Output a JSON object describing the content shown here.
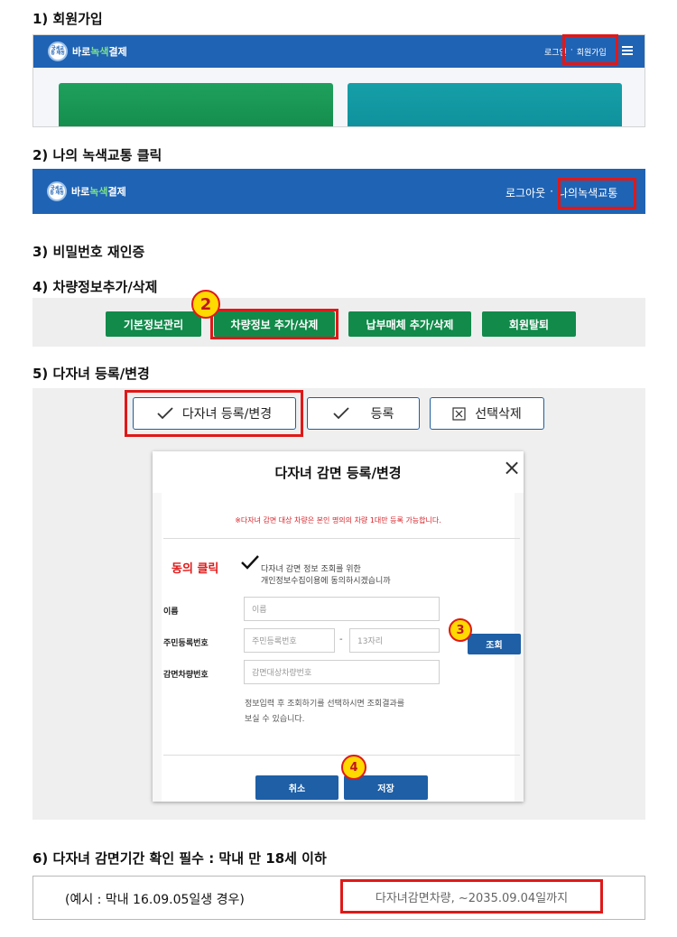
{
  "steps": {
    "s1": "1) 회원가입",
    "s2": "2) 나의 녹색교통 클릭",
    "s3": "3) 비밀번호 재인증",
    "s4": "4) 차량정보추가/삭제",
    "s5": "5) 다자녀 등록/변경",
    "s6": "6) 다자녀 감면기간 확인 필수 : 막내 만 18세 이하"
  },
  "logo": {
    "badge": "국세교통 재정",
    "text_a": "바로",
    "text_b": "녹색",
    "text_c": "결제"
  },
  "nav1": {
    "login": "로그인",
    "dot": "·",
    "signup": "회원가입"
  },
  "nav2": {
    "logout": "로그아웃",
    "dot": "·",
    "mygreen": "나의녹색교통"
  },
  "menu_buttons": [
    "기본정보관리",
    "차량정보 추가/삭제",
    "납부매체 추가/삭제",
    "회원탈퇴"
  ],
  "action_buttons": {
    "register_change": "다자녀 등록/변경",
    "register": "등록",
    "delete_selected": "선택삭제"
  },
  "badges": {
    "b2": "2",
    "b3": "3",
    "b4": "4"
  },
  "modal": {
    "title": "다자녀 감면 등록/변경",
    "close": "×",
    "notice": "※다자녀 감면 대상 차량은 본인 명의의 차량 1대만 등록 가능합니다.",
    "agree_label": "동의 클릭",
    "agree_text_1": "다자녀 감면 정보 조회를 위한",
    "agree_text_2": "개인정보수집이용에 동의하시겠습니까",
    "name_label": "이름",
    "name_placeholder": "이름",
    "rrn_label": "주민등록번호",
    "rrn_placeholder_1": "주민등록번호",
    "rrn_dash": "-",
    "rrn_placeholder_2": "13자리",
    "query_button": "조회",
    "car_label": "감면차량번호",
    "car_placeholder": "감면대상차량번호",
    "help_1": "정보입력 후 조회하기를 선택하시면 조회결과를",
    "help_2": "보실 수 있습니다.",
    "cancel_button": "취소",
    "save_button": "저장"
  },
  "example": {
    "text": "(예시 : 막내 16.09.05일생 경우)",
    "result": "다자녀감면차량, ~2035.09.04일까지"
  },
  "colors": {
    "nav_blue": "#1f63b4",
    "green_button": "#118a4a",
    "highlight_red": "#e01818",
    "badge_yellow": "#ffd900"
  }
}
